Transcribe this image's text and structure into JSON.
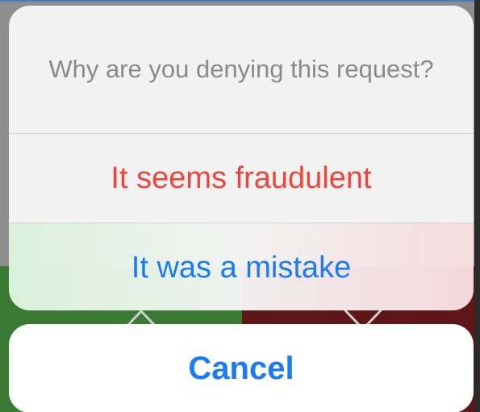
{
  "action_sheet": {
    "title": "Why are you denying this request?",
    "actions": [
      {
        "label": "It seems fraudulent",
        "style": "destructive",
        "color": "#f0443a"
      },
      {
        "label": "It was a mistake",
        "style": "default",
        "color": "#1a7cf3"
      }
    ],
    "cancel_label": "Cancel"
  },
  "background": {
    "left_panel_color": "#3a7a35",
    "right_panel_color": "#5e1618",
    "left_icon": "chevron-down-icon",
    "right_icon": "close-icon"
  }
}
